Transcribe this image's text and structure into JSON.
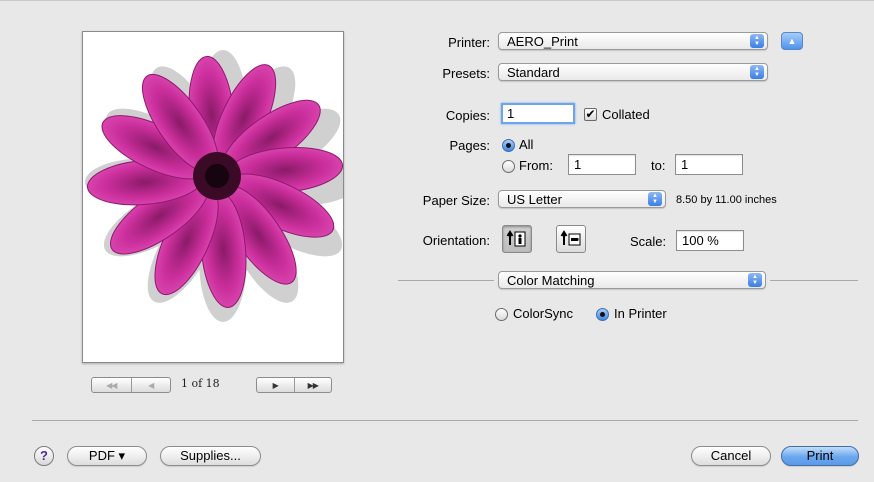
{
  "preview": {
    "page_indicator": "1 of 18",
    "nav_first": "◀◀",
    "nav_prev": "◀",
    "nav_next": "▶",
    "nav_last": "▶▶"
  },
  "printer": {
    "label": "Printer:",
    "value": "AERO_Print"
  },
  "presets": {
    "label": "Presets:",
    "value": "Standard"
  },
  "copies": {
    "label": "Copies:",
    "value": "1",
    "collated_label": "Collated",
    "collated": true
  },
  "pages": {
    "label": "Pages:",
    "all_label": "All",
    "from_label": "From:",
    "from_value": "1",
    "to_label": "to:",
    "to_value": "1",
    "selected": "All"
  },
  "paper_size": {
    "label": "Paper Size:",
    "value": "US Letter",
    "dimensions": "8.50 by 11.00 inches"
  },
  "orientation": {
    "label": "Orientation:",
    "selected": "portrait"
  },
  "scale": {
    "label": "Scale:",
    "value": "100 %"
  },
  "panel": {
    "value": "Color Matching"
  },
  "color_matching": {
    "colorsync_label": "ColorSync",
    "in_printer_label": "In Printer",
    "selected": "In Printer"
  },
  "buttons": {
    "help": "?",
    "pdf": "PDF ▾",
    "supplies": "Supplies...",
    "cancel": "Cancel",
    "print": "Print"
  },
  "colors": {
    "accent": "#3a7ee6",
    "flower": "#c2298f"
  }
}
